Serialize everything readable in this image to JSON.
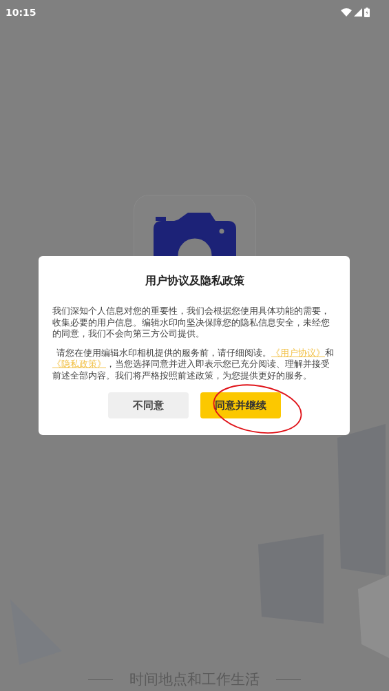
{
  "status_bar": {
    "time": "10:15"
  },
  "splash": {
    "tagline": "时间地点和工作生活"
  },
  "dialog": {
    "title": "用户协议及隐私政策",
    "paragraphs": [
      [
        {
          "kind": "text",
          "text": "我们深知个人信息对您的重要性，我们会根据您使用具体功能的需要，收集必要的用户信息。编辑水印向坚决保障您的隐私信息安全，未经您的同意，我们不会向第三方公司提供。"
        }
      ],
      [
        {
          "kind": "text",
          "text": "请您在使用编辑水印相机提供的服务前，请仔细阅读。"
        },
        {
          "kind": "link",
          "text": "《用户协议》"
        },
        {
          "kind": "text",
          "text": "和"
        },
        {
          "kind": "link",
          "text": "《隐私政策》"
        },
        {
          "kind": "text",
          "text": "，当您选择同意并进入即表示您已充分阅读、理解并接受前述全部内容。我们将严格按照前述政策，为您提供更好的服务。"
        }
      ]
    ],
    "buttons": [
      {
        "label": "不同意",
        "kind": "secondary"
      },
      {
        "label": "同意并继续",
        "kind": "primary"
      }
    ]
  }
}
